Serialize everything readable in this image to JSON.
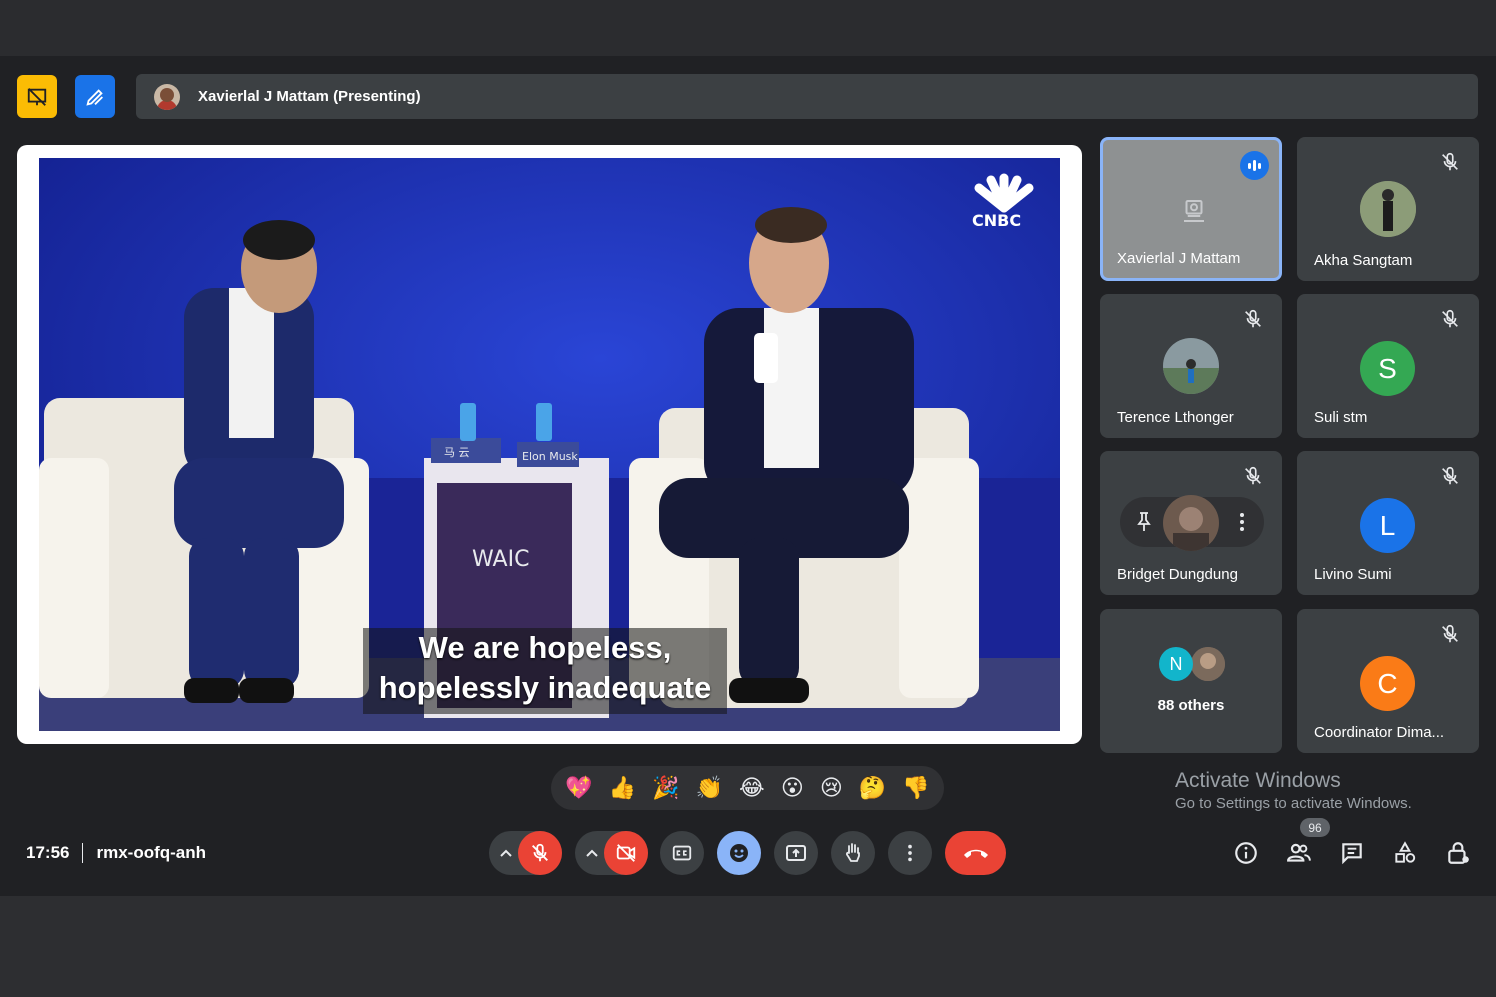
{
  "presenter": {
    "name": "Xavierlal J Mattam (Presenting)"
  },
  "video": {
    "logo_text": "CNBC",
    "placard_left": "马 云",
    "placard_right": "Elon Musk",
    "podium_text": "WAIC",
    "caption_line1": "We are hopeless,",
    "caption_line2": "hopelessly inadequate"
  },
  "participants": [
    {
      "name": "Xavierlal J Mattam",
      "state": "speaking"
    },
    {
      "name": "Akha Sangtam",
      "state": "muted"
    },
    {
      "name": "Terence Lthonger",
      "state": "muted"
    },
    {
      "name": "Suli stm",
      "initial": "S",
      "color": "#34a853",
      "state": "muted"
    },
    {
      "name": "Bridget Dungdung",
      "state": "muted"
    },
    {
      "name": "Livino Sumi",
      "initial": "L",
      "color": "#1a73e8",
      "state": "muted"
    },
    {
      "name": "88 others",
      "initial": "N",
      "color": "#12b5cb"
    },
    {
      "name": "Coordinator Dima...",
      "initial": "C",
      "color": "#fa7b17",
      "state": "muted"
    }
  ],
  "watermark": {
    "title": "Activate Windows",
    "subtitle": "Go to Settings to activate Windows."
  },
  "reactions": [
    "💖",
    "👍",
    "🎉",
    "👏",
    "😂",
    "😮",
    "😢",
    "🤔",
    "👎"
  ],
  "meeting": {
    "time": "17:56",
    "code": "rmx-oofq-anh"
  },
  "people_count": "96",
  "colors": {
    "background": "#202124",
    "tile": "#3c4043",
    "accent": "#8ab4f8",
    "danger": "#ea4335"
  }
}
